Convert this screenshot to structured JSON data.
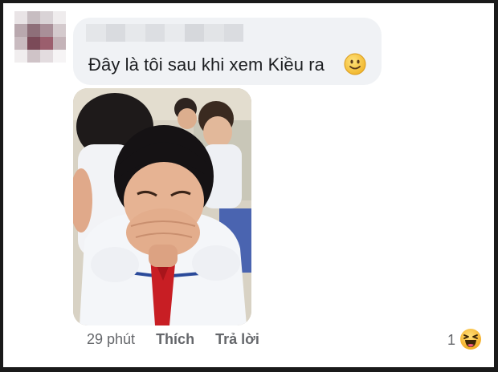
{
  "comment": {
    "author_name": "",
    "text": "Đây là tôi sau khi xem Kiều ra",
    "emoji": "slightly-smiling-face-icon"
  },
  "attachment": {
    "type": "photo",
    "subject": "girl crying in school uniform with red scarf"
  },
  "actions": {
    "time": "29 phút",
    "like_label": "Thích",
    "reply_label": "Trả lời"
  },
  "reactions": {
    "count": "1",
    "icon": "haha-reaction-icon"
  },
  "colors": {
    "bubble_bg": "#f0f2f5",
    "meta_text": "#65676b",
    "body_text": "#1c1e21",
    "emoji_yellow": "#f7c23b"
  }
}
